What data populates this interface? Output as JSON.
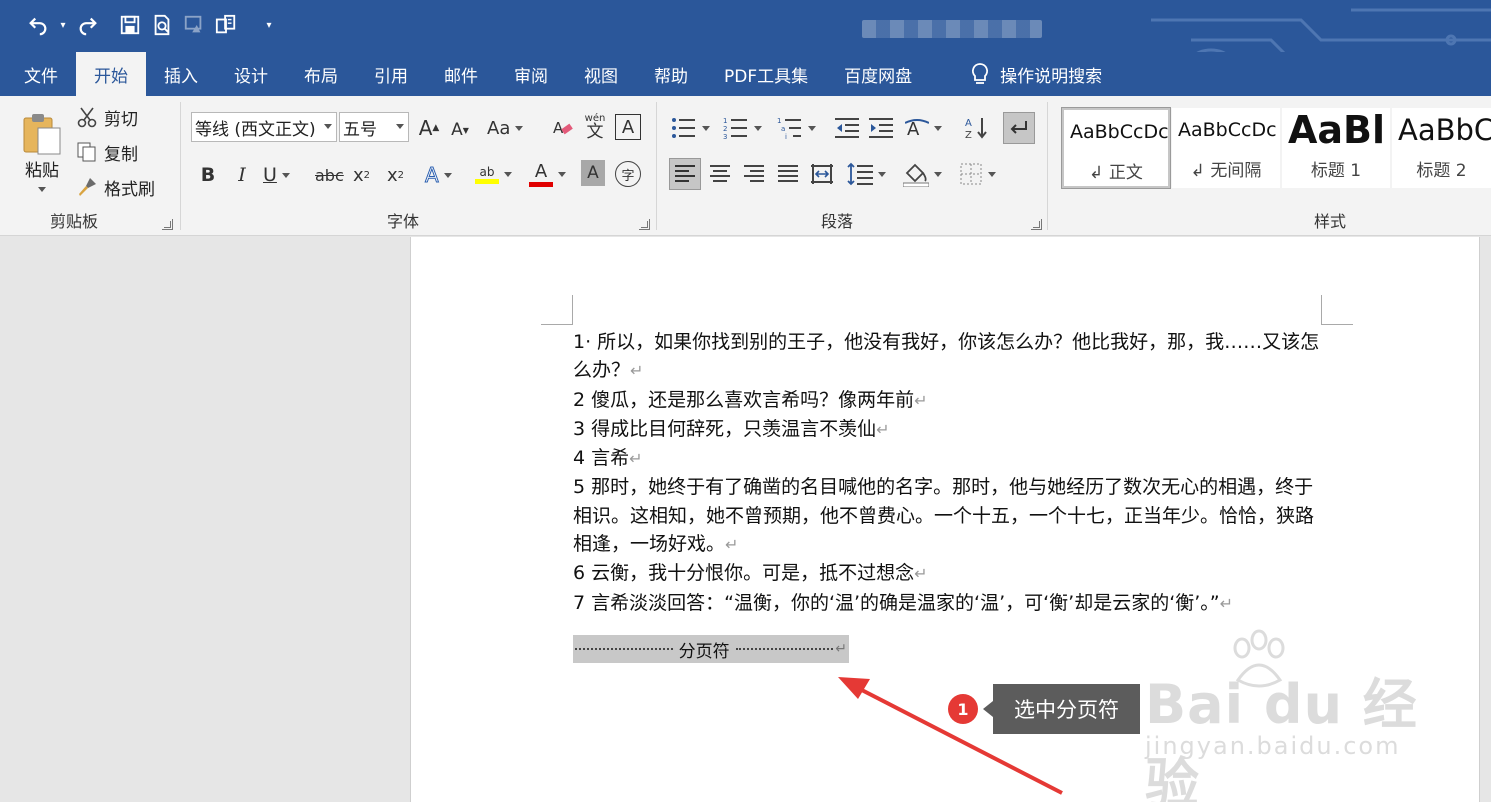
{
  "qat": {
    "undo": "undo-icon",
    "redo": "redo-icon",
    "save": "save-icon",
    "print_preview": "print-preview-icon",
    "touch_mode": "touch-mode-icon",
    "paste_special": "paste-special-icon",
    "customize": "customize-qat-icon"
  },
  "tabs": [
    "文件",
    "开始",
    "插入",
    "设计",
    "布局",
    "引用",
    "邮件",
    "审阅",
    "视图",
    "帮助",
    "PDF工具集",
    "百度网盘"
  ],
  "active_tab": "开始",
  "tell_me": "操作说明搜索",
  "clipboard": {
    "paste": "粘贴",
    "cut": "剪切",
    "copy": "复制",
    "format_painter": "格式刷",
    "label": "剪贴板"
  },
  "font": {
    "family": "等线 (西文正文)",
    "size": "五号",
    "grow": "A",
    "shrink": "A",
    "change_case": "Aa",
    "phonetic_top": "wén",
    "phonetic_bottom": "文",
    "border_char": "A",
    "bold": "B",
    "italic": "I",
    "underline": "U",
    "strike": "abc",
    "subscript": "x",
    "sub_mark": "2",
    "superscript": "x",
    "sup_mark": "2",
    "effects": "A",
    "highlight": "ab",
    "color": "A",
    "shading": "A",
    "enclose": "字",
    "label": "字体"
  },
  "paragraph": {
    "label": "段落"
  },
  "styles": {
    "label": "样式",
    "items": [
      {
        "sample": "AaBbCcDc",
        "name": "↲ 正文"
      },
      {
        "sample": "AaBbCcDc",
        "name": "↲ 无间隔"
      },
      {
        "sample": "AaBl",
        "name": "标题 1"
      },
      {
        "sample": "AaBbC",
        "name": "标题 2"
      }
    ]
  },
  "document": {
    "lines": [
      {
        "num": "1·",
        "text": " 所以，如果你找到别的王子，他没有我好，你该怎么办？他比我好，那，我……又该怎么办？"
      },
      {
        "num": "2",
        "text": " 傻瓜，还是那么喜欢言希吗？像两年前"
      },
      {
        "num": "3",
        "text": " 得成比目何辞死，只羡温言不羡仙"
      },
      {
        "num": "4",
        "text": " 言希"
      },
      {
        "num": "5",
        "text": " 那时，她终于有了确凿的名目喊他的名字。那时，他与她经历了数次无心的相遇，终于相识。这相知，她不曾预期，他不曾费心。一个十五，一个十七，正当年少。恰恰，狭路相逢，一场好戏。"
      },
      {
        "num": "6",
        "text": " 云衡，我十分恨你。可是，抵不过想念"
      },
      {
        "num": "7",
        "text": " 言希淡淡回答：“温衡，你的‘温’的确是温家的‘温’，可‘衡’却是云家的‘衡’。”"
      }
    ],
    "para_mark": "↵",
    "page_break": "分页符"
  },
  "annotation": {
    "badge": "1",
    "callout": "选中分页符"
  },
  "watermark": {
    "brand": "Bai du 经验",
    "sub": "jingyan.baidu.com"
  }
}
